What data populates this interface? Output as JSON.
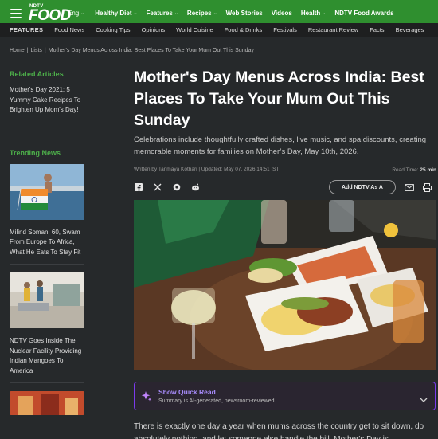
{
  "nav": {
    "logo_small": "NDTV",
    "logo_big": "FOOD",
    "language": "Eng",
    "items": [
      {
        "label": "Healthy Diet",
        "dropdown": true
      },
      {
        "label": "Features",
        "dropdown": true
      },
      {
        "label": "Recipes",
        "dropdown": true
      },
      {
        "label": "Web Stories",
        "dropdown": false
      },
      {
        "label": "Videos",
        "dropdown": false
      },
      {
        "label": "Health",
        "dropdown": true
      },
      {
        "label": "NDTV Food Awards",
        "dropdown": false
      }
    ]
  },
  "subnav": {
    "label": "FEATURES",
    "items": [
      "Food News",
      "Cooking Tips",
      "Opinions",
      "World Cuisine",
      "Food & Drinks",
      "Festivals",
      "Restaurant Review",
      "Facts",
      "Beverages"
    ]
  },
  "breadcrumb": [
    "Home",
    "Lists",
    "Mother's Day Menus Across India: Best Places To Take Your Mum Out This Sunday"
  ],
  "sidebar": {
    "related_heading": "Related Articles",
    "related": [
      "Mother's Day 2021: 5 Yummy Cake Recipes To Brighten Up Mom's Day!"
    ],
    "trending_heading": "Trending News",
    "trending": [
      "Milind Soman, 60, Swam From Europe To Africa, What He Eats To Stay Fit",
      "NDTV Goes Inside The Nuclear Facility Providing Indian Mangoes To America"
    ]
  },
  "article": {
    "title": "Mother's Day Menus Across India: Best Places To Take Your Mum Out This Sunday",
    "subtitle": "Celebrations include thoughtfully crafted dishes, live music, and spa discounts, creating memorable moments for families on Mother’s Day, May 10th, 2026.",
    "author": "Written by Tanmaya Kothari",
    "updated": "Updated: May 07, 2026 14:51 IST",
    "read_time_label": "Read Time:",
    "read_time_value": "25 min",
    "add_button": "Add NDTV As A",
    "body_start": "There is exactly one day a year when mums across the country get to sit down, do absolutely nothing, and let someone else handle the bill. Mother's Day is"
  },
  "quick_read": {
    "title": "Show Quick Read",
    "subtitle": "Summary is AI-generated, newsroom-reviewed"
  },
  "colors": {
    "brand_green": "#2f8f2f",
    "accent_green": "#4db04a",
    "quick_read_purple": "#7c3aed",
    "background": "#26292b"
  },
  "icons": [
    "hamburger-icon",
    "facebook-icon",
    "x-icon",
    "whatsapp-icon",
    "reddit-icon",
    "mail-icon",
    "print-icon",
    "sparkle-icon",
    "chevron-down-icon"
  ]
}
